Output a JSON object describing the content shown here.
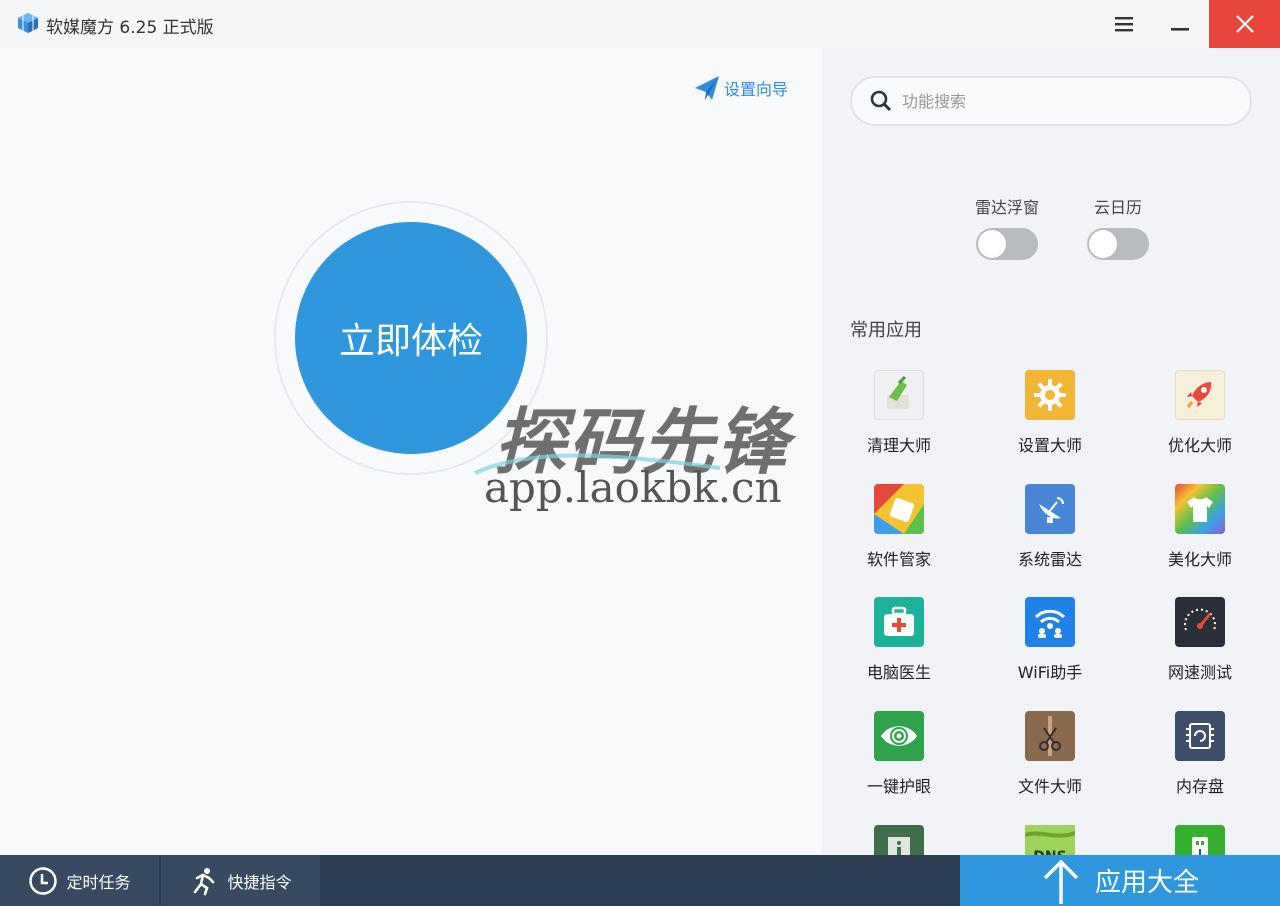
{
  "window": {
    "title": "软媒魔方 6.25 正式版"
  },
  "main": {
    "wizard_label": "设置向导",
    "check_button_label": "立即体检"
  },
  "watermark": {
    "title": "探码先锋",
    "url": "app.laokbk.cn"
  },
  "sidebar": {
    "search_placeholder": "功能搜索",
    "toggles": [
      {
        "label": "雷达浮窗",
        "on": false
      },
      {
        "label": "云日历",
        "on": false
      }
    ],
    "section_title": "常用应用",
    "apps": [
      {
        "label": "清理大师",
        "icon": "broom-icon",
        "color": "#eef0f2"
      },
      {
        "label": "设置大师",
        "icon": "gear-icon",
        "color": "#f2b634"
      },
      {
        "label": "优化大师",
        "icon": "rocket-icon",
        "color": "#f6efda"
      },
      {
        "label": "软件管家",
        "icon": "software-icon",
        "color": "#3aa0e8"
      },
      {
        "label": "系统雷达",
        "icon": "radar-dish-icon",
        "color": "#4a86d8"
      },
      {
        "label": "美化大师",
        "icon": "tshirt-icon",
        "color": "#8b5fd0"
      },
      {
        "label": "电脑医生",
        "icon": "first-aid-icon",
        "color": "#1cb39a"
      },
      {
        "label": "WiFi助手",
        "icon": "wifi-icon",
        "color": "#1e82e8"
      },
      {
        "label": "网速测试",
        "icon": "speedometer-icon",
        "color": "#2b2f38"
      },
      {
        "label": "一键护眼",
        "icon": "eye-icon",
        "color": "#2fa34a"
      },
      {
        "label": "文件大师",
        "icon": "scissors-icon",
        "color": "#8a6a4c"
      },
      {
        "label": "内存盘",
        "icon": "memory-chip-icon",
        "color": "#3d4f6a"
      },
      {
        "label": "",
        "icon": "info-icon",
        "color": "#3f6e4a"
      },
      {
        "label": "",
        "icon": "dns-icon",
        "color": "#7bbf3a"
      },
      {
        "label": "",
        "icon": "usb-icon",
        "color": "#35b02f"
      }
    ]
  },
  "bottombar": {
    "timer_label": "定时任务",
    "shortcut_label": "快捷指令",
    "apps_label": "应用大全"
  },
  "colors": {
    "accent": "#2f97de",
    "close": "#e8453c",
    "bottombar": "#2e3e52"
  }
}
